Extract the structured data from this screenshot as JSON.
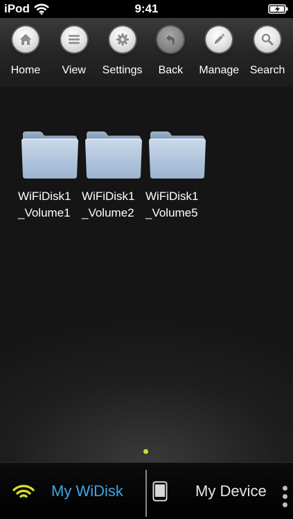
{
  "status_bar": {
    "carrier": "iPod",
    "time": "9:41"
  },
  "toolbar": {
    "items": [
      {
        "label": "Home",
        "icon": "home-icon"
      },
      {
        "label": "View",
        "icon": "list-icon"
      },
      {
        "label": "Settings",
        "icon": "gear-icon"
      },
      {
        "label": "Back",
        "icon": "back-arrow-icon"
      },
      {
        "label": "Manage",
        "icon": "pencil-icon"
      },
      {
        "label": "Search",
        "icon": "search-icon"
      }
    ]
  },
  "folders": [
    {
      "name_line1": "WiFiDisk1",
      "name_line2": "_Volume1"
    },
    {
      "name_line1": "WiFiDisk1",
      "name_line2": "_Volume2"
    },
    {
      "name_line1": "WiFiDisk1",
      "name_line2": "_Volume5"
    }
  ],
  "tabbar": {
    "widisk_label": "My WiDisk",
    "device_label": "My Device"
  },
  "colors": {
    "accent_blue": "#3aa8e8",
    "page_dot": "#c8dd3c",
    "wifi_yellow": "#d7dc2a"
  }
}
